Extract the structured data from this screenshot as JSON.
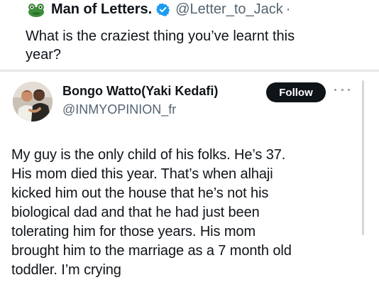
{
  "quoted_tweet": {
    "author_name": "Man of Letters.",
    "handle": "@Letter_to_Jack",
    "separator": "·",
    "text_lines": [
      "What is the craziest thing you’ve learnt this",
      "year?"
    ],
    "avatar_icon": "frog-emoji-avatar",
    "verified_icon": "verified-badge-icon"
  },
  "main_tweet": {
    "author_name": "Bongo Watto(Yaki Kedafi)",
    "handle": "@INMYOPINION_fr",
    "follow_label": "Follow",
    "more_icon": "more-options-icon",
    "text_lines": [
      "My guy is the only child of his folks. He’s 37.",
      "His mom died this year. That’s when alhaji",
      "kicked him out the house that he’s not his",
      "biological dad and that he had just been",
      "tolerating him for those years. His mom",
      "brought him to the marriage as a 7 month old",
      "toddler. I’m crying"
    ]
  },
  "colors": {
    "text_primary": "#0f1419",
    "text_secondary": "#536471",
    "verified_blue": "#1d9bf0",
    "follow_bg": "#0f1419",
    "follow_text": "#ffffff"
  }
}
